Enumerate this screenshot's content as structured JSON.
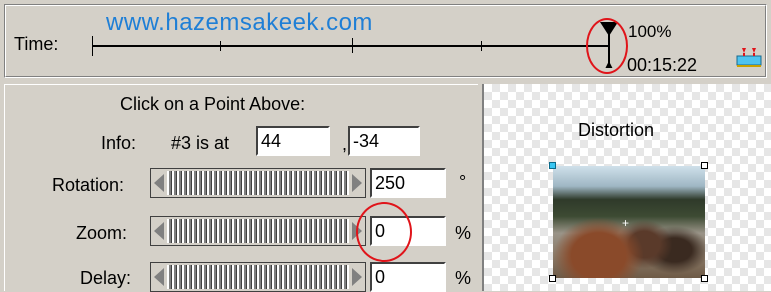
{
  "timeline": {
    "label": "Time:",
    "watermark": "www.hazemsakeek.com",
    "percent": "100%",
    "timecode": "00:15:22",
    "icon": "filmstrip-icon"
  },
  "point_info": {
    "heading": "Click on a Point Above:",
    "info_label": "Info:",
    "info_text": "#3 is at",
    "x_value": "44",
    "separator": ",",
    "y_value": "-34"
  },
  "sliders": [
    {
      "label": "Rotation:",
      "value": "250",
      "unit": "°"
    },
    {
      "label": "Zoom:",
      "value": "0",
      "unit": "%"
    },
    {
      "label": "Delay:",
      "value": "0",
      "unit": "%"
    }
  ],
  "preview": {
    "title": "Distortion"
  },
  "colors": {
    "annotation": "#e0141a",
    "watermark": "#1f7fd6",
    "handle_selected": "#39c6f2"
  }
}
